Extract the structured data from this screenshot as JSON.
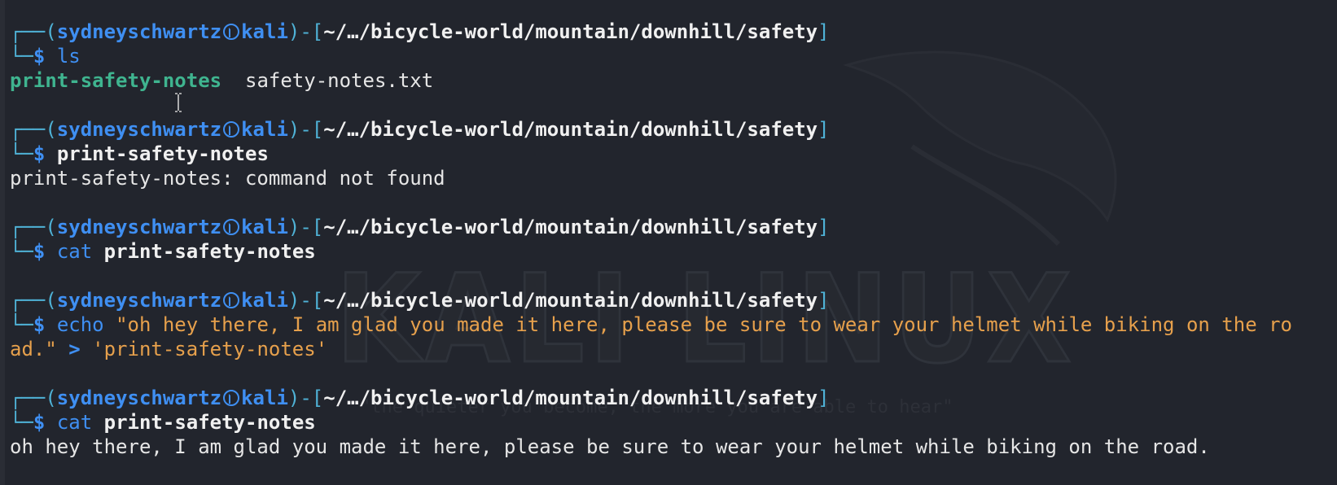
{
  "watermark": {
    "text": "KALI LINUX",
    "tagline": "\"the quieter you become, the more you are able to hear\""
  },
  "prompt": {
    "user": "sydneyschwartz",
    "host": "kali",
    "path": "~/…/bicycle-world/mountain/downhill/safety",
    "symbol": "$"
  },
  "blocks": [
    {
      "cmd": "ls",
      "output": {
        "file1": "print-safety-notes",
        "sep": "  ",
        "file2": "safety-notes.txt"
      }
    },
    {
      "cmd": "print-safety-notes",
      "output": "print-safety-notes: command not found"
    },
    {
      "cmd_prefix": "cat",
      "cmd_arg": "print-safety-notes"
    },
    {
      "cmd_prefix": "echo",
      "cmd_string": "\"oh hey there, I am glad you made it here, please be sure to wear your helmet while biking on the ro",
      "cmd_string_cont": "ad.\"",
      "redirect": ">",
      "target": "'print-safety-notes'"
    },
    {
      "cmd_prefix": "cat",
      "cmd_arg": "print-safety-notes",
      "output": "oh hey there, I am glad you made it here, please be sure to wear your helmet while biking on the road."
    }
  ]
}
